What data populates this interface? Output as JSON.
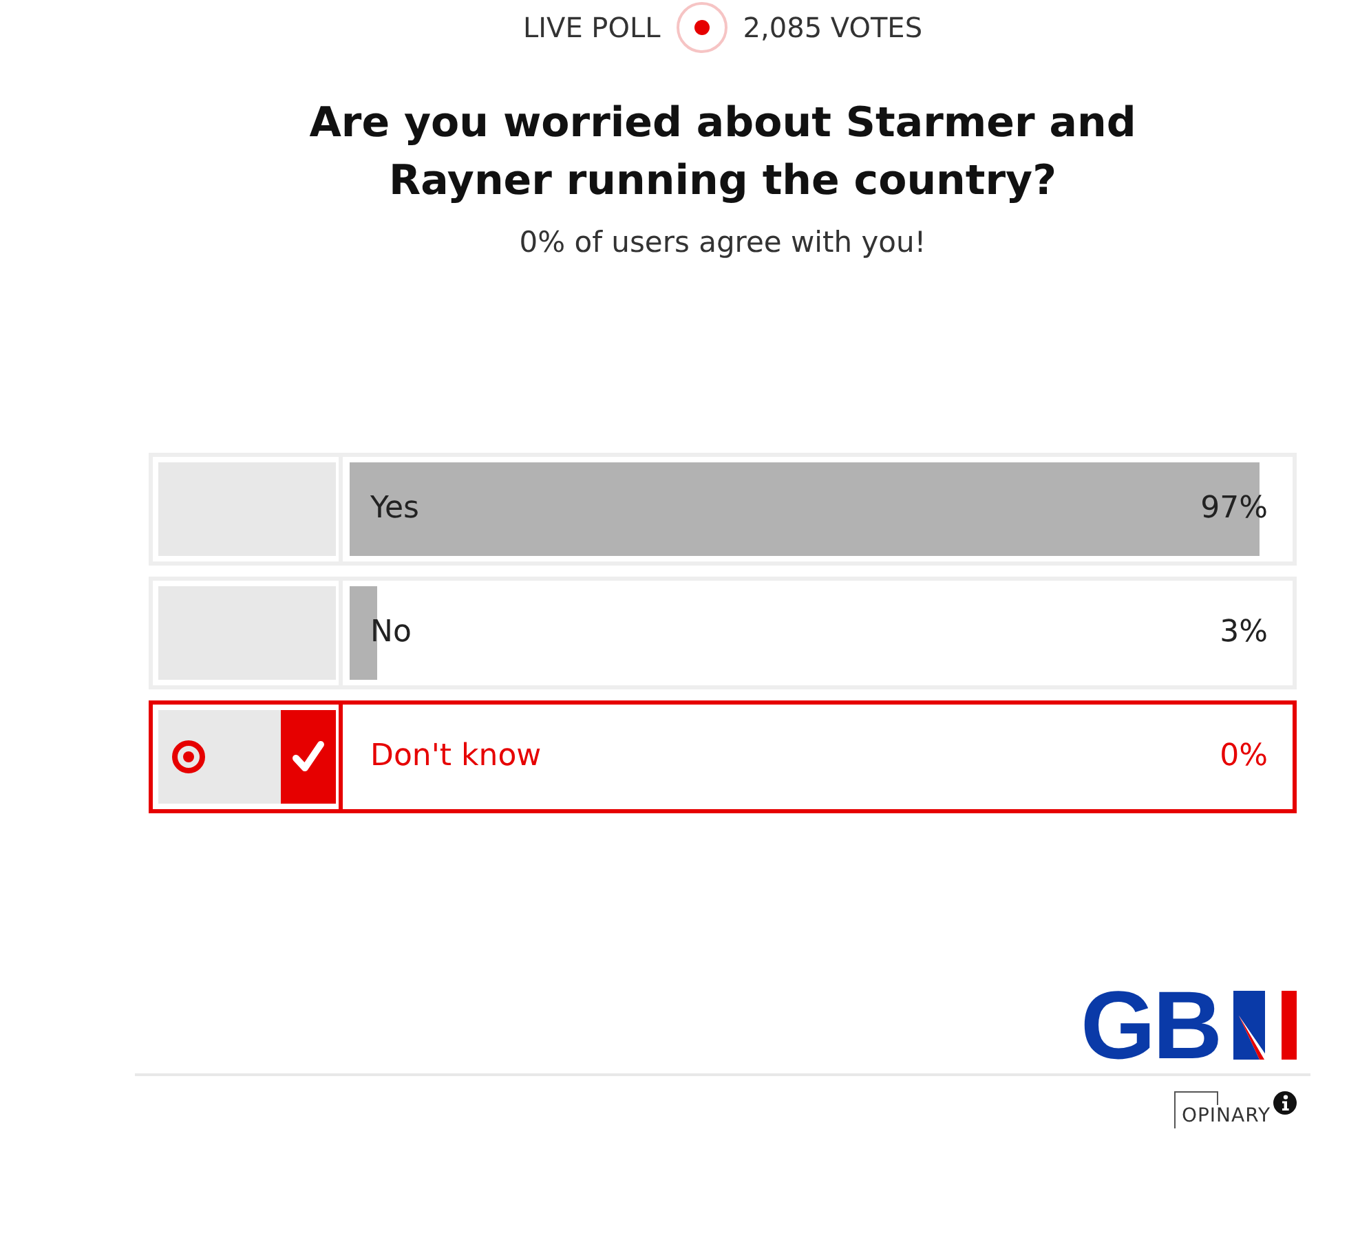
{
  "header": {
    "label": "LIVE POLL",
    "votes": "2,085 VOTES"
  },
  "question": "Are you worried about Starmer and Rayner running the country?",
  "result_message": "0% of users agree with you!",
  "options": [
    {
      "label": "Yes",
      "percent": "97%",
      "level": 0.97,
      "selected": false
    },
    {
      "label": "No",
      "percent": "3%",
      "level": 0.03,
      "selected": false
    },
    {
      "label": "Don't know",
      "percent": "0%",
      "selected": true
    }
  ],
  "brand": {
    "logo_text": "GB"
  },
  "footer": {
    "provider": "OPINARY"
  }
}
